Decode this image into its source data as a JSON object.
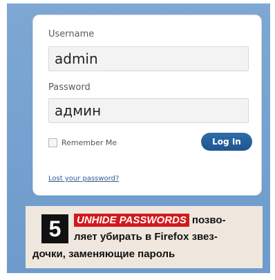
{
  "form": {
    "username_label": "Username",
    "username_value": "admin",
    "password_label": "Password",
    "password_value": "админ",
    "remember_label": "Remember Me",
    "login_button": "Log In",
    "lost_password_link": "Lost your password?"
  },
  "caption": {
    "number": "5",
    "tag": "UNHIDE PASSWORDS",
    "line1_rest": "позво-",
    "line2": "ляет убирать в Firefox звез-",
    "line3": "дочки, заменяющие пароль"
  },
  "colors": {
    "frame_bg": "#7ea7d3",
    "button_bg": "#2f6ca8",
    "tag_bg": "#d11a1e",
    "caption_bg": "#efe7dd"
  }
}
